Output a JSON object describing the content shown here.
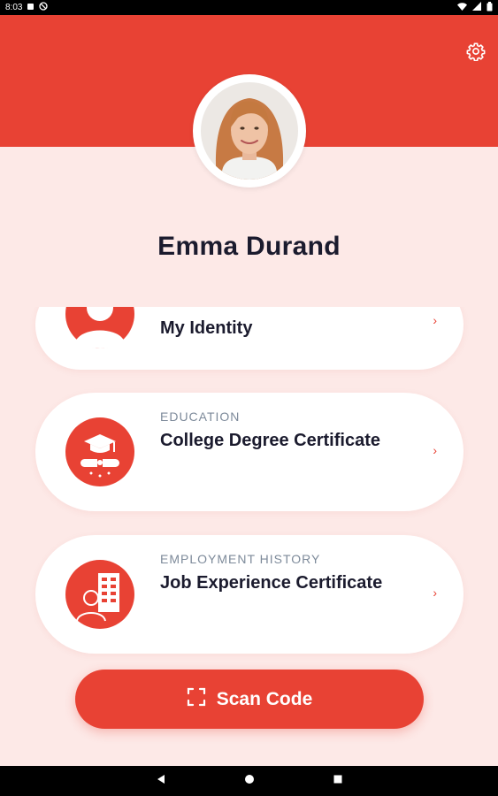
{
  "status_bar": {
    "time": "8:03"
  },
  "profile": {
    "name": "Emma Durand"
  },
  "cards": [
    {
      "category": "",
      "title": "My Identity",
      "chevron": "›"
    },
    {
      "category": "EDUCATION",
      "title": "College Degree Certificate",
      "chevron": "›"
    },
    {
      "category": "EMPLOYMENT HISTORY",
      "title": "Job Experience Certificate",
      "chevron": "›"
    }
  ],
  "scan_button": {
    "label": "Scan Code",
    "icon": "scan-frame-icon"
  },
  "icons": {
    "settings": "gear-icon",
    "back": "back-icon",
    "home": "home-icon",
    "recents": "recents-icon"
  },
  "colors": {
    "accent": "#e84234",
    "background": "#fde9e7",
    "text": "#1b1b2e",
    "muted": "#7d8a9a"
  }
}
